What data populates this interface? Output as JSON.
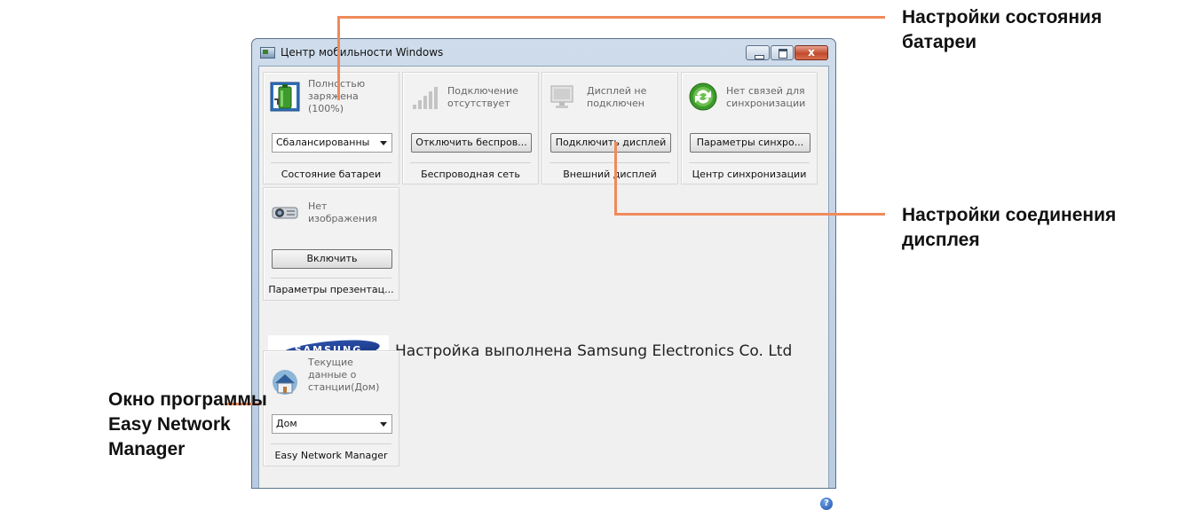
{
  "window": {
    "title": "Центр мобильности Windows",
    "close_glyph": "x"
  },
  "tiles": {
    "battery": {
      "status": "Полностью заряжена (100%)",
      "select_value": "Сбалансированны",
      "title": "Состояние батареи",
      "icon": "battery-icon"
    },
    "wireless": {
      "status": "Подключение отсутствует",
      "button": "Отключить беспров...",
      "title": "Беспроводная сеть",
      "icon": "signal-bars-icon"
    },
    "display": {
      "status": "Дисплей не подключен",
      "button": "Подключить дисплей",
      "title": "Внешний дисплей",
      "icon": "monitor-icon"
    },
    "sync": {
      "status": "Нет связей для синхронизации",
      "button": "Параметры синхро...",
      "title": "Центр синхронизации",
      "icon": "sync-icon"
    },
    "presentation": {
      "status": "Нет изображения",
      "button": "Включить",
      "title": "Параметры презентац...",
      "icon": "projector-icon"
    },
    "network": {
      "status": "Текущие данные о станции(Дом)",
      "select_value": "Дом",
      "title": "Easy Network Manager",
      "icon": "house-icon"
    }
  },
  "samsung": {
    "logo_text": "SAMSUNG",
    "caption": "Настройка выполнена Samsung Electronics Co. Ltd"
  },
  "help_glyph": "?",
  "callouts": {
    "battery_settings": [
      "Настройки состояния",
      "батареи"
    ],
    "display_settings": [
      "Настройки соединения",
      "дисплея"
    ],
    "enm_window": [
      "Окно программы",
      "Easy Network",
      "Manager"
    ]
  },
  "colors": {
    "callout_line": "#f08a5b",
    "title_gradient_top": "#cfdceb",
    "client_bg": "#f0f0f0"
  }
}
